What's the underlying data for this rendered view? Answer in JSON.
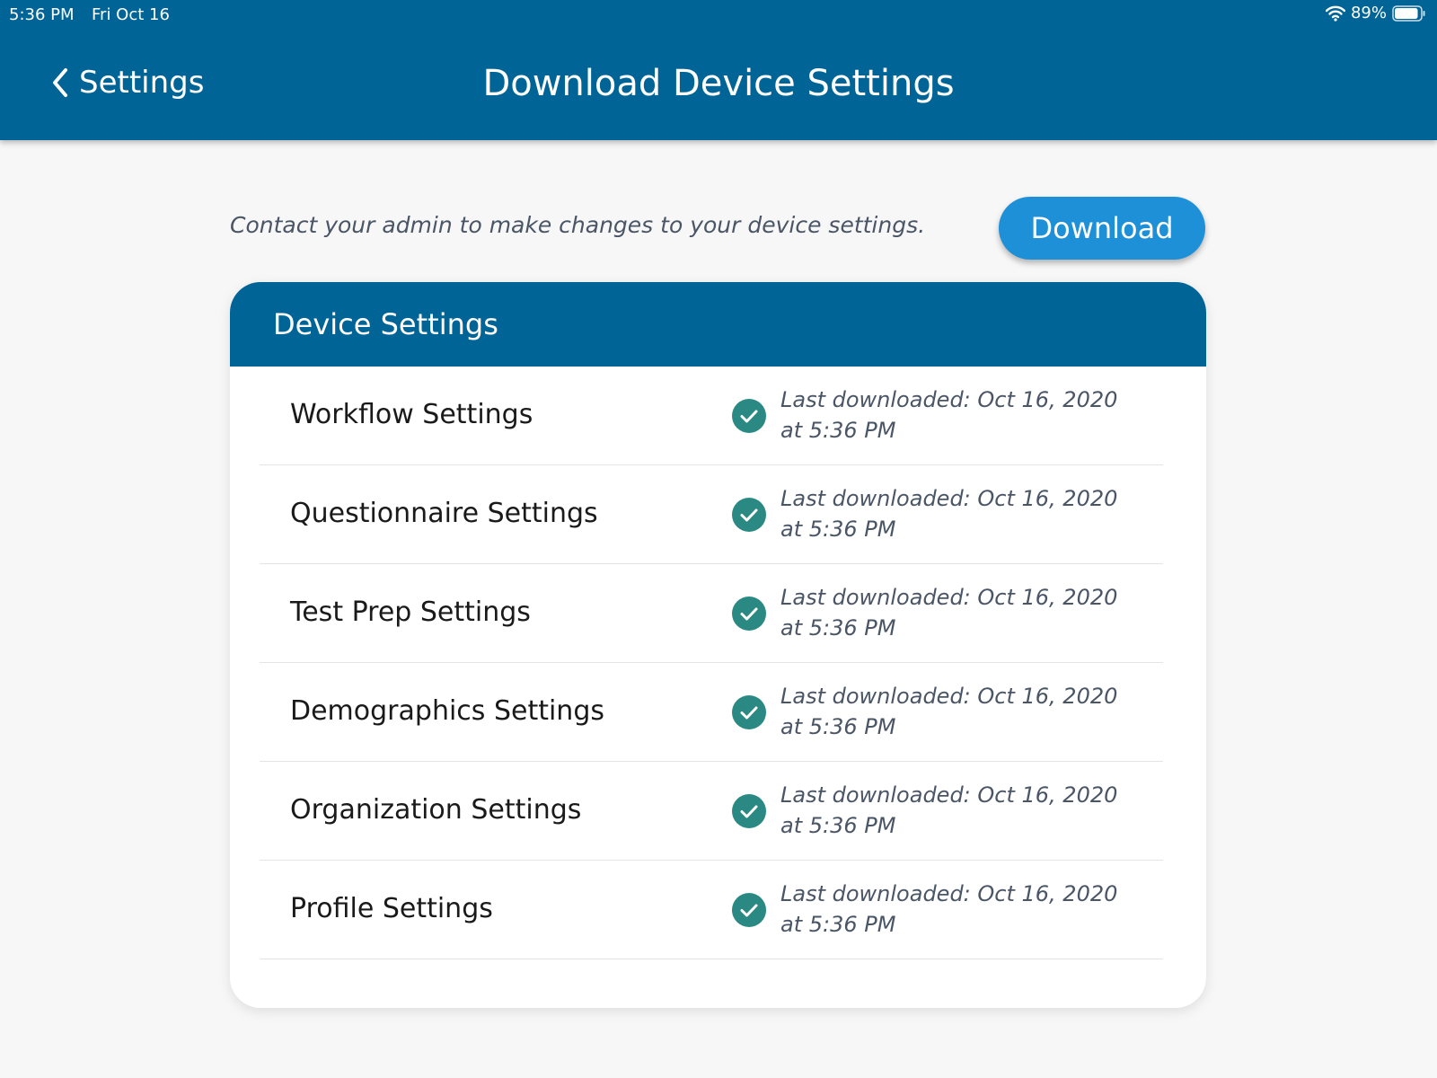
{
  "status_bar": {
    "time": "5:36 PM",
    "date": "Fri Oct 16",
    "battery": "89%"
  },
  "nav": {
    "back_label": "Settings",
    "title": "Download Device Settings"
  },
  "notice": "Contact your admin to make changes to your device settings.",
  "download_label": "Download",
  "card": {
    "title": "Device Settings",
    "rows": [
      {
        "label": "Workflow Settings",
        "status": "Last downloaded: Oct 16, 2020 at 5:36 PM"
      },
      {
        "label": "Questionnaire Settings",
        "status": "Last downloaded: Oct 16, 2020 at 5:36 PM"
      },
      {
        "label": "Test Prep Settings",
        "status": "Last downloaded: Oct 16, 2020 at 5:36 PM"
      },
      {
        "label": "Demographics Settings",
        "status": "Last downloaded: Oct 16, 2020 at 5:36 PM"
      },
      {
        "label": "Organization Settings",
        "status": "Last downloaded: Oct 16, 2020 at 5:36 PM"
      },
      {
        "label": "Profile Settings",
        "status": "Last downloaded: Oct 16, 2020 at 5:36 PM"
      }
    ]
  },
  "colors": {
    "primary": "#006496",
    "accent": "#1e90d8",
    "success": "#2a8a83"
  },
  "icons": {
    "back": "chevron-left-icon",
    "check": "check-circle-icon",
    "wifi": "wifi-icon",
    "battery": "battery-icon"
  }
}
